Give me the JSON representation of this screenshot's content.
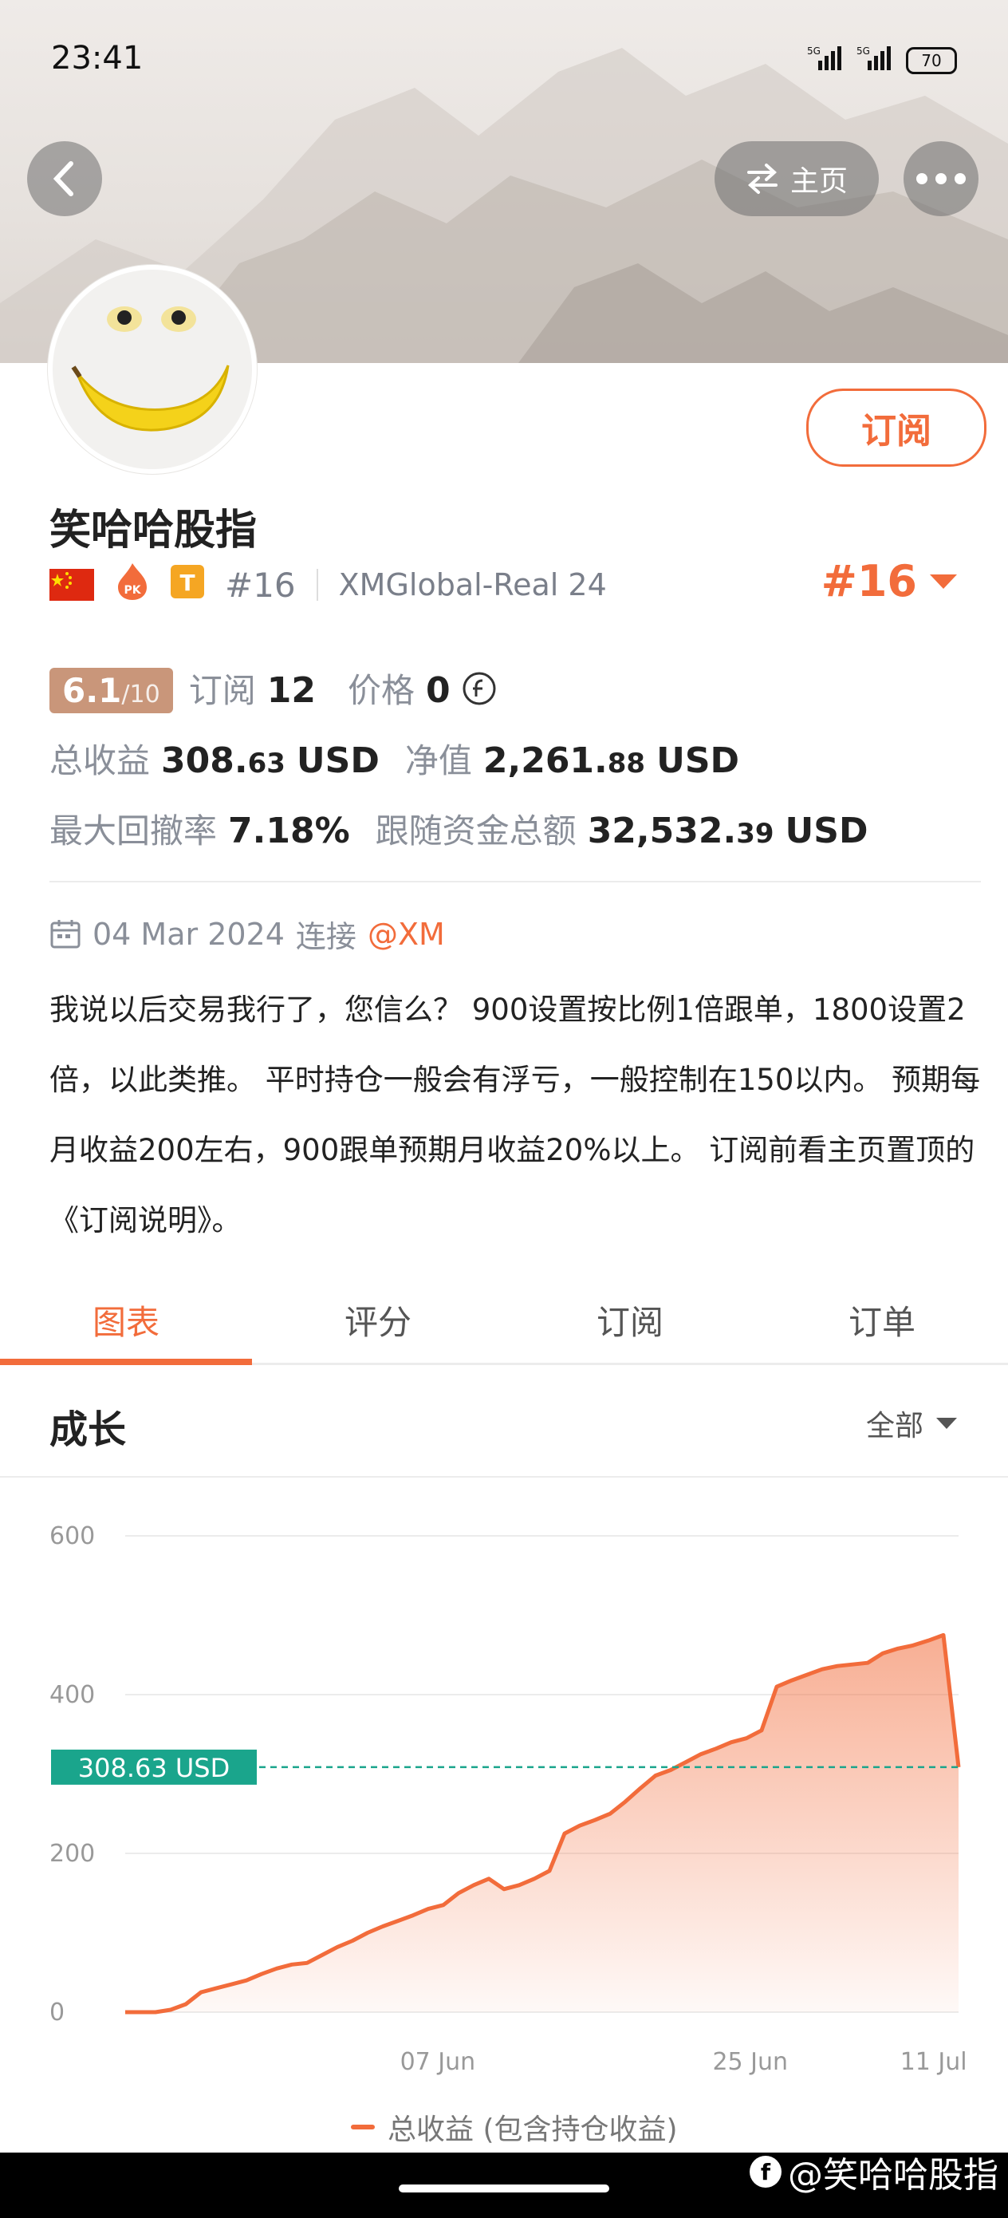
{
  "status_bar": {
    "time": "23:41",
    "signal1": "5G",
    "signal2": "5G",
    "battery": "70"
  },
  "header": {
    "home_label": "主页"
  },
  "profile": {
    "name": "笑哈哈股指",
    "subscribe_label": "订阅",
    "rank_small": "#16",
    "broker": "XMGlobal-Real 24",
    "rank_big": "#16",
    "pk_badge": "PK",
    "t_badge": "T"
  },
  "stats": {
    "score_main": "6.1",
    "score_denom": "/10",
    "subs_label": "订阅",
    "subs_value": "12",
    "price_label": "价格",
    "price_value": "0",
    "total_profit_label": "总收益",
    "total_profit_int": "308.",
    "total_profit_dec": "63",
    "total_profit_unit": "USD",
    "equity_label": "净值",
    "equity_int": "2,261.",
    "equity_dec": "88",
    "equity_unit": "USD",
    "drawdown_label": "最大回撤率",
    "drawdown_value": "7.18%",
    "follow_label": "跟随资金总额",
    "follow_int": "32,532.",
    "follow_dec": "39",
    "follow_unit": "USD"
  },
  "connection": {
    "date": "04 Mar 2024",
    "connect_label": "连接",
    "at": "@XM"
  },
  "description": "我说以后交易我行了，您信么？ 900设置按比例1倍跟单，1800设置2倍，以此类推。 平时持仓一般会有浮亏，一般控制在150以内。 预期每月收益200左右，900跟单预期月收益20%以上。 订阅前看主页置顶的《订阅说明》。",
  "tabs": [
    {
      "label": "图表"
    },
    {
      "label": "评分"
    },
    {
      "label": "订阅"
    },
    {
      "label": "订单"
    }
  ],
  "section": {
    "title": "成长",
    "range": "全部"
  },
  "chart_data": {
    "type": "area",
    "ylim": [
      0,
      600
    ],
    "yticks": [
      "0",
      "200",
      "400",
      "600"
    ],
    "xticks": [
      "07 Jun",
      "25 Jun",
      "11 Jul"
    ],
    "current_label": "308.63 USD",
    "current_value": 308.63,
    "series": [
      {
        "name": "总收益 (包含持仓收益)",
        "values": [
          0,
          0,
          0,
          3,
          10,
          25,
          30,
          35,
          40,
          48,
          55,
          60,
          62,
          72,
          82,
          90,
          100,
          108,
          115,
          122,
          130,
          135,
          150,
          160,
          168,
          155,
          160,
          168,
          178,
          225,
          235,
          242,
          250,
          265,
          282,
          298,
          305,
          315,
          325,
          332,
          340,
          345,
          355,
          410,
          418,
          425,
          432,
          436,
          438,
          440,
          452,
          458,
          462,
          468,
          475,
          308.63
        ]
      }
    ],
    "accent": "#f26c3b",
    "reference_color": "#1aa58c"
  },
  "legend": {
    "label": "总收益 (包含持仓收益)"
  },
  "watermark": {
    "text": "@笑哈哈股指"
  }
}
